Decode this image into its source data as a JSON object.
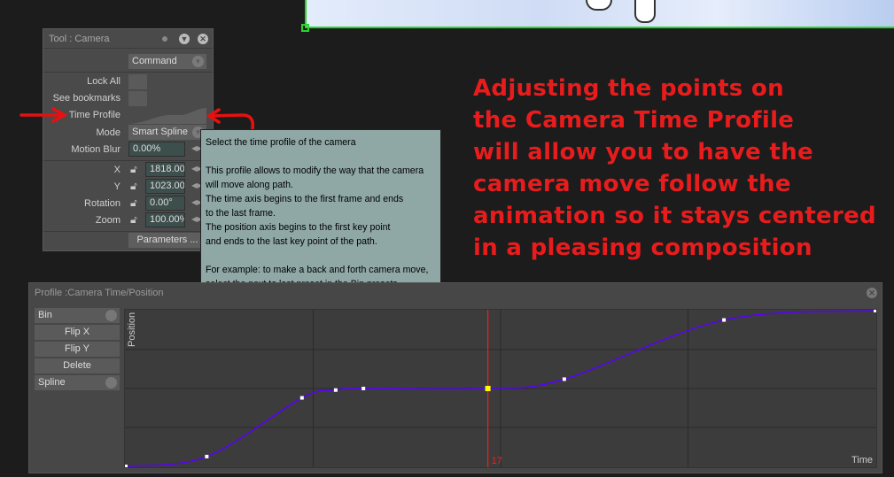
{
  "tool_panel": {
    "title": "Tool : Camera",
    "command": "Command",
    "lock_all": "Lock All",
    "see_bookmarks": "See bookmarks",
    "time_profile": "Time Profile",
    "mode_label": "Mode",
    "mode_value": "Smart Spline",
    "motion_blur_label": "Motion Blur",
    "motion_blur_value": "0.00%",
    "x_label": "X",
    "x_value": "1818.00",
    "y_label": "Y",
    "y_value": "1023.00",
    "rotation_label": "Rotation",
    "rotation_value": "0.00°",
    "zoom_label": "Zoom",
    "zoom_value": "100.00%",
    "parameters": "Parameters ..."
  },
  "tooltip": {
    "text": "Select the time profile of the camera\n\nThis profile allows to modify the way that the camera\nwill move along path.\nThe time axis begins to the first frame and ends\nto the last frame.\nThe position axis begins to the first key point\nand ends to the last key point of the path.\n\nFor example: to make a back and forth camera move,\nselect the next to last preset in the Bin presets."
  },
  "annotation": {
    "lines": [
      "Adjusting the points on",
      "the Camera Time Profile",
      "will allow you to have the",
      "camera move follow the",
      "animation so it stays centered",
      "in a pleasing composition"
    ],
    "color": "#e81c1c"
  },
  "profile_panel": {
    "title": "Profile :Camera Time/Position",
    "bin": "Bin",
    "flip_x": "Flip X",
    "flip_y": "Flip Y",
    "delete": "Delete",
    "spline": "Spline"
  },
  "chart_data": {
    "type": "line",
    "xlabel": "Time",
    "ylabel": "Position",
    "xlim": [
      0,
      1
    ],
    "ylim": [
      0,
      1
    ],
    "grid": true,
    "curve_color": "#5a00ff",
    "points": [
      [
        0,
        0
      ],
      [
        0.108,
        0.063
      ],
      [
        0.235,
        0.44
      ],
      [
        0.28,
        0.49
      ],
      [
        0.317,
        0.5
      ],
      [
        0.483,
        0.5
      ],
      [
        0.585,
        0.56
      ],
      [
        0.798,
        0.94
      ],
      [
        1,
        1
      ]
    ],
    "selected_point_index": 5,
    "playhead": {
      "time": 0.483,
      "label": "17",
      "color": "#ff1a1a"
    }
  }
}
